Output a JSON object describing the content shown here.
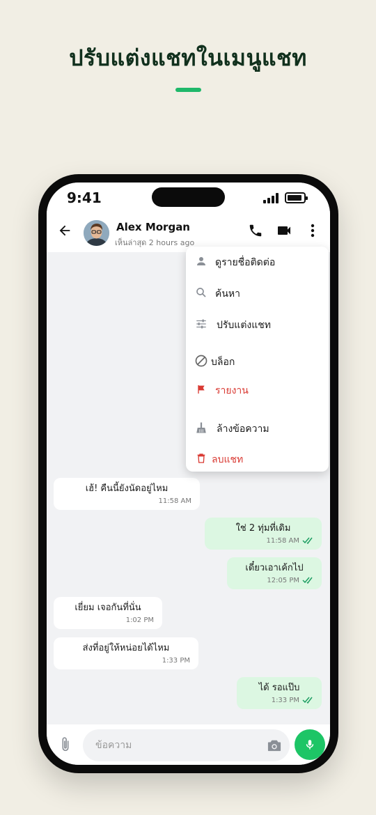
{
  "headline": "ปรับแต่งแชทในเมนูแชท",
  "status_bar": {
    "time": "9:41"
  },
  "header": {
    "contact_name": "Alex Morgan",
    "last_seen": "เห็นล่าสุด 2 hours ago"
  },
  "menu": {
    "items": [
      {
        "label": "ดูรายชื่อติดต่อ",
        "icon": "person-icon"
      },
      {
        "label": "ค้นหา",
        "icon": "search-icon"
      },
      {
        "label": "ปรับแต่งแชท",
        "icon": "tune-icon"
      },
      {
        "label": "บล็อก",
        "icon": "block-icon"
      },
      {
        "label": "รายงาน",
        "icon": "flag-icon"
      },
      {
        "label": "ล้างข้อความ",
        "icon": "broom-icon"
      },
      {
        "label": "ลบแชท",
        "icon": "trash-icon"
      }
    ]
  },
  "messages": [
    {
      "direction": "in",
      "text": "เฮ้! คืนนี้ยังนัดอยู่ไหม",
      "time": "11:58 AM"
    },
    {
      "direction": "out",
      "text": "ใช่ 2 ทุ่มที่เดิม",
      "time": "11:58 AM"
    },
    {
      "direction": "out",
      "text": "เดี๋ยวเอาเค้กไป",
      "time": "12:05 PM"
    },
    {
      "direction": "in",
      "text": "เยี่ยม เจอกันที่นั่น",
      "time": "1:02 PM"
    },
    {
      "direction": "in",
      "text": "ส่งที่อยู่ให้หน่อยได้ไหม",
      "time": "1:33 PM"
    },
    {
      "direction": "out",
      "text": "ได้ รอแป๊บ",
      "time": "1:33 PM"
    }
  ],
  "composer": {
    "placeholder": "ข้อความ"
  },
  "colors": {
    "accent": "#1dc566",
    "outgoing_bubble": "#dcf7e2",
    "danger": "#d93a33",
    "headline": "#11301d",
    "background": "#f1eee4"
  }
}
